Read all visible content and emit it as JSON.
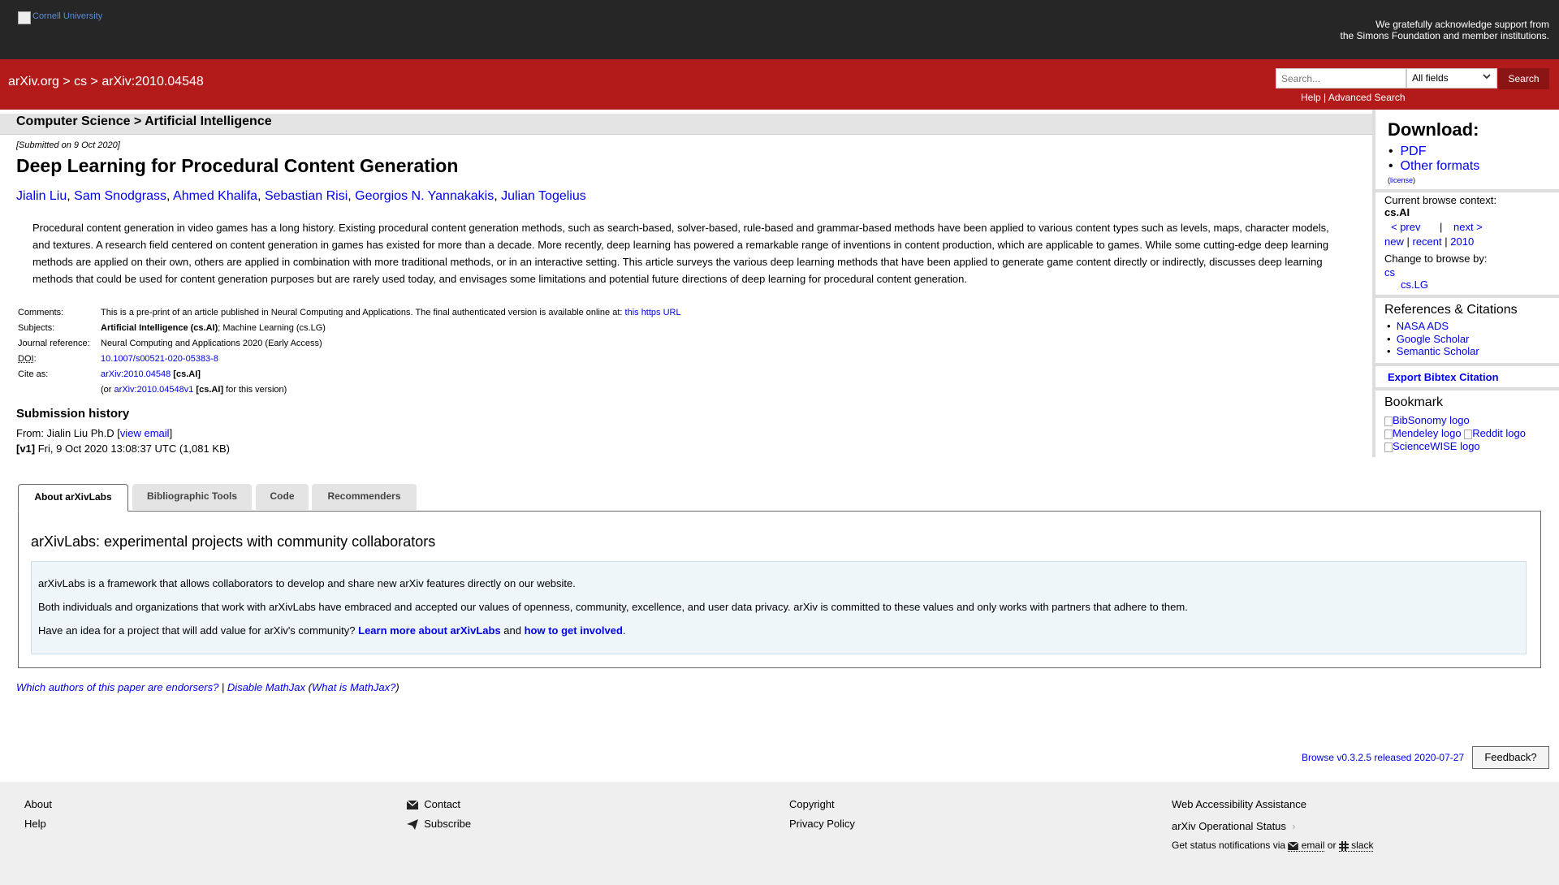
{
  "header": {
    "logo_alt": "Cornell University",
    "support_line1": "We gratefully acknowledge support from",
    "support_line2": "the Simons Foundation and member institutions.",
    "breadcrumb": [
      "arXiv.org",
      ">",
      "cs",
      ">",
      "arXiv:2010.04548"
    ],
    "search_placeholder": "Search...",
    "search_field": "All fields",
    "search_button": "Search",
    "help_link": "Help",
    "separator": "|",
    "advanced_search": "Advanced Search"
  },
  "subject_header": "Computer Science > Artificial Intelligence",
  "paper": {
    "submitted": "[Submitted on 9 Oct 2020]",
    "title": "Deep Learning for Procedural Content Generation",
    "authors": [
      "Jialin Liu",
      "Sam Snodgrass",
      "Ahmed Khalifa",
      "Sebastian Risi",
      "Georgios N. Yannakakis",
      "Julian Togelius"
    ],
    "abstract": "Procedural content generation in video games has a long history. Existing procedural content generation methods, such as search-based, solver-based, rule-based and grammar-based methods have been applied to various content types such as levels, maps, character models, and textures. A research field centered on content generation in games has existed for more than a decade. More recently, deep learning has powered a remarkable range of inventions in content production, which are applicable to games. While some cutting-edge deep learning methods are applied on their own, others are applied in combination with more traditional methods, or in an interactive setting. This article surveys the various deep learning methods that have been applied to generate game content directly or indirectly, discusses deep learning methods that could be used for content generation purposes but are rarely used today, and envisages some limitations and potential future directions of deep learning for procedural content generation."
  },
  "metadata": {
    "comments_label": "Comments:",
    "comments_text": "This is a pre-print of an article published in Neural Computing and Applications. The final authenticated version is available online at: ",
    "comments_link": "this https URL",
    "subjects_label": "Subjects:",
    "subjects_primary": "Artificial Intelligence (cs.AI)",
    "subjects_rest": "; Machine Learning (cs.LG)",
    "journal_label": "Journal reference:",
    "journal_value": "Neural Computing and Applications 2020 (Early Access)",
    "doi_label": "DOI",
    "doi_colon": ":",
    "doi_value": "10.1007/s00521-020-05383-8",
    "cite_label": "Cite as:",
    "cite_id": "arXiv:2010.04548",
    "cite_cat": "[cs.AI]",
    "cite_or": "(or ",
    "cite_version": "arXiv:2010.04548v1",
    "cite_version_cat": "[cs.AI]",
    "cite_version_suffix": " for this version)"
  },
  "history": {
    "heading": "Submission history",
    "from_prefix": "From: Jialin Liu Ph.D [",
    "view_email": "view email",
    "from_suffix": "]",
    "v1_label": "[v1]",
    "v1_text": " Fri, 9 Oct 2020 13:08:37 UTC (1,081 KB)"
  },
  "tabs": [
    "About arXivLabs",
    "Bibliographic Tools",
    "Code",
    "Recommenders"
  ],
  "labs": {
    "heading": "arXivLabs: experimental projects with community collaborators",
    "p1": "arXivLabs is a framework that allows collaborators to develop and share new arXiv features directly on our website.",
    "p2": "Both individuals and organizations that work with arXivLabs have embraced and accepted our values of openness, community, excellence, and user data privacy. arXiv is committed to these values and only works with partners that adhere to them.",
    "p3_prefix": "Have an idea for a project that will add value for arXiv's community? ",
    "p3_link1": "Learn more about arXivLabs",
    "p3_and": " and ",
    "p3_link2": "how to get involved",
    "p3_suffix": "."
  },
  "bottom_links": {
    "endorsers": "Which authors of this paper are endorsers?",
    "sep": " | ",
    "mathjax": "Disable MathJax",
    "paren_open": " (",
    "what_mathjax": "What is MathJax?",
    "paren_close": ")"
  },
  "version_info": "Browse v0.3.2.5 released 2020-07-27",
  "feedback": "Feedback?",
  "sidebar": {
    "download_heading": "Download:",
    "pdf": "PDF",
    "other_formats": "Other formats",
    "license": "license",
    "context_label": "Current browse context:",
    "context_value": "cs.AI",
    "prev": "< prev",
    "pipe": "|",
    "next": "next >",
    "new": "new",
    "recent": "recent",
    "year": "2010",
    "change_label": "Change to browse by:",
    "browse_cs": "cs",
    "browse_lg": "cs.LG",
    "refs_heading": "References & Citations",
    "nasa": "NASA ADS",
    "scholar": "Google Scholar",
    "semantic": "Semantic Scholar",
    "bibtex": "Export Bibtex Citation",
    "bookmark_heading": "Bookmark",
    "bibsonomy": "BibSonomy logo",
    "mendeley": "Mendeley logo",
    "reddit": "Reddit logo",
    "sciencewise": "ScienceWISE logo"
  },
  "footer": {
    "about": "About",
    "help": "Help",
    "contact": "Contact",
    "subscribe": "Subscribe",
    "copyright": "Copyright",
    "privacy": "Privacy Policy",
    "accessibility": "Web Accessibility Assistance",
    "status": "arXiv Operational Status",
    "notify_prefix": "Get status notifications via ",
    "email": "email",
    "or": " or ",
    "slack": "slack"
  },
  "colors": {
    "header_dark": "#262626",
    "header_red": "#b31b1b",
    "link": "#0000ee"
  }
}
